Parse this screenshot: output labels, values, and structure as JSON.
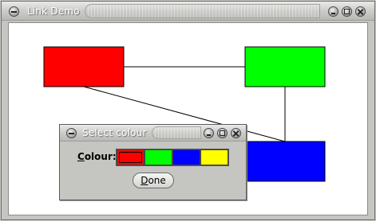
{
  "main_window": {
    "title": "Link Demo",
    "nodes": [
      {
        "name": "red-node",
        "color": "#ff0000"
      },
      {
        "name": "green-node",
        "color": "#00ff00"
      },
      {
        "name": "blue-node",
        "color": "#0000ff"
      }
    ],
    "links": [
      [
        "red-node",
        "green-node"
      ],
      [
        "red-node",
        "blue-node"
      ],
      [
        "green-node",
        "blue-node"
      ]
    ]
  },
  "dialog": {
    "title": "Select colour",
    "colour_label_mnemonic": "C",
    "colour_label_rest": "olour:",
    "swatches": [
      {
        "name": "red",
        "color": "#ff0000"
      },
      {
        "name": "green",
        "color": "#00ff00"
      },
      {
        "name": "blue",
        "color": "#0000ff"
      },
      {
        "name": "yellow",
        "color": "#ffff00"
      }
    ],
    "done_mnemonic": "D",
    "done_rest": "one"
  },
  "icons": {
    "window_menu": "window-menu-icon",
    "minimize": "minimize-icon",
    "maximize": "maximize-icon",
    "close": "close-icon"
  }
}
